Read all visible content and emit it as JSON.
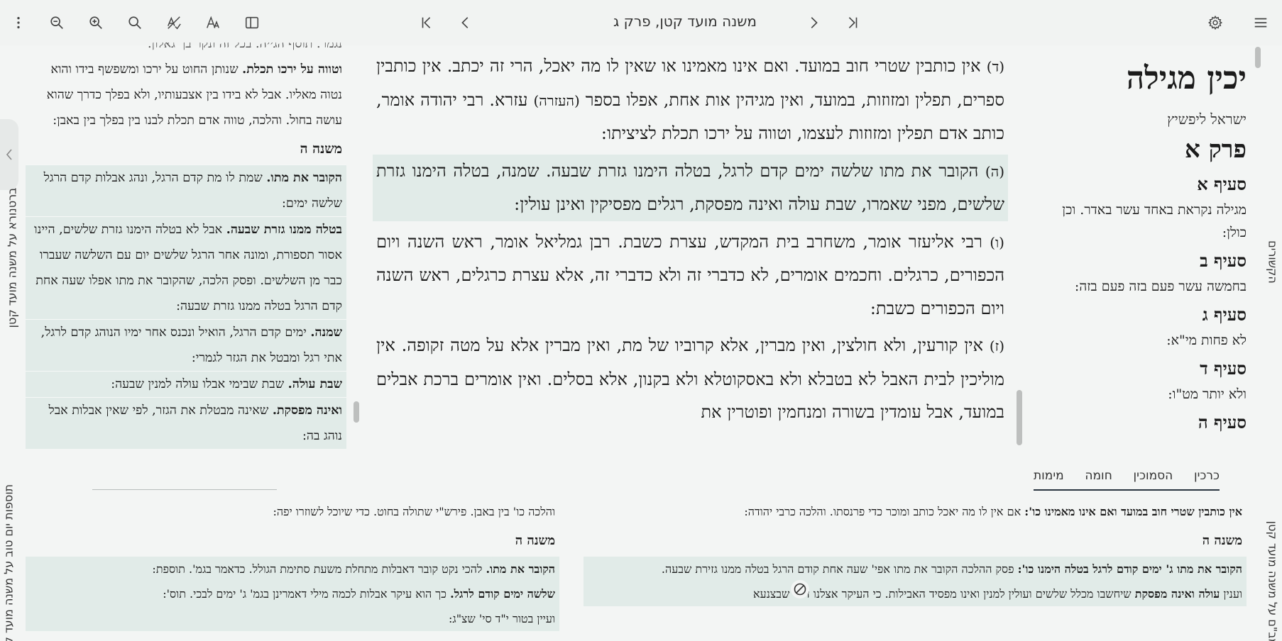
{
  "toolbar": {
    "title": "משנה מועד קטן, פרק ג",
    "icons": [
      "more-vertical-icon",
      "zoom-out-icon",
      "zoom-in-icon",
      "search-icon",
      "spellcheck-off-icon",
      "font-icon",
      "split-view-icon",
      "first-page-icon",
      "prev-page-icon",
      "next-page-icon",
      "last-page-icon",
      "settings-icon",
      "menu-icon"
    ]
  },
  "main": {
    "p4": {
      "num": "(ד)",
      "text1": " אין כותבין שטרי חוב במועד. ואם אינו מאמינו או שאין לו מה יאכל, הרי זה יכתב. אין כותבין ספרים, תפלין ומזוזות, במועד, ואין מגיהין אות אחת, אפלו בספר ",
      "ezra": "(העזרה)",
      "text2": " עזרא. רבי יהודה אומר, כותב אדם תפלין ומזוזות לעצמו, וטווה על ירכו תכלת לציציתו:"
    },
    "p5": {
      "num": "(ה)",
      "text": " הקובר את מתו שלשה ימים קדם לרגל, בטלה הימנו גזרת שבעה. שמנה, בטלה הימנו גזרת שלשים, מפני שאמרו, שבת עולה ואינה מפסקת, רגלים מפסיקין ואינן עולין:"
    },
    "p6": {
      "num": "(ו)",
      "text": " רבי אליעזר אומר, משחרב בית המקדש, עצרת כשבת. רבן גמליאל אומר, ראש השנה ויום הכפורים, כרגלים. וחכמים אומרים, לא כדברי זה ולא כדברי זה, אלא עצרת כרגלים, ראש השנה ויום הכפורים כשבת:"
    },
    "p7": {
      "num": "(ז)",
      "text": " אין קורעין, ולא חולצין, ואין מברין, אלא קרוביו של מת, ואין מברין אלא על מטה זקופה. אין מוליכין לבית האבל לא בטבלא ולא באסקוטלא ולא בקנון, אלא בסלים. ואין אומרים ברכת אבלים במועד, אבל עומדין בשורה ומנחמין ופוטרין את"
    }
  },
  "right": {
    "title": "יכין מגילה",
    "author": "ישראל ליפשיץ",
    "chapter": "פרק א",
    "sections": [
      {
        "label": "סעיף א",
        "text": "מגילה נקראת באחד עשר באדר. וכן כולן:"
      },
      {
        "label": "סעיף ב",
        "text": "בחמשה עשר פעם בזה פעם בזה:"
      },
      {
        "label": "סעיף ג",
        "text": "לא פחות מי\"א:"
      },
      {
        "label": "סעיף ד",
        "text": "ולא יותר מט\"ו:"
      },
      {
        "label": "סעיף ה",
        "text": ""
      }
    ],
    "tabs": [
      "כרכין",
      "הסמוכין",
      "חומה",
      "מימות"
    ]
  },
  "left": {
    "top_partial": "נגמר. תוסף הגייה. בכל זה ונקר בך גאלון.",
    "p_tovah": {
      "bold": "וטווה על ירכו תכלת.",
      "text": " שנותן החוט על ירכו ומשפשף בידו והוא נטוה מאליו. אבל לא בידו בין אצבעותיו, ולא בפלך כדרך שהוא עושה בחול. והלכה, טווה אדם תכלת לבנו בין בפלך בין באבן:"
    },
    "header": "משנה ה",
    "p1": {
      "bold": "הקובר את מתו.",
      "text": " שמת לו מת קדם הרגל, ונהג אבלות קדם הרגל שלשה ימים:"
    },
    "p2": {
      "bold": "בטלה ממנו גזרת שבעה.",
      "text": " אבל לא בטלה הימנו גזרת שלשים, היינו אסור תספורת, ומונה אחר הרגל שלשים יום עם השלשה שעברו כבר מן השלשים. ופסק הלכה, שהקובר את מתו אפלו שעה אחת קדם הרגל בטלה ממנו גזרת שבעה:"
    },
    "p3": {
      "bold": "שמנה.",
      "text": " ימים קדם הרגל, הואיל ונכנס אחר ימיו הנוהג קדם לרגל, אתי רגל ומבטל את הגזר לגמרי:"
    },
    "p4": {
      "bold": "שבת עולה.",
      "text": " שבת שבימי אבלו עולה למנין שבעה:"
    },
    "p5": {
      "bold": "ואינה מפסקת.",
      "text": " שאינה מבטלת את הגזר, לפי שאין אבלות אבל נוהג בה:"
    },
    "vlabel": "ברטנורא על משנה מועד קטן"
  },
  "bottom_left": {
    "top": "והלכה כו' בין באבן. פירש\"י שתולה בחוט. כדי שיוכל לשוזרו יפה:",
    "header": "משנה ה",
    "p1": {
      "bold": "הקובר את מתו.",
      "text": " להכי נקט קובר דאבלות מתחלת משעת סתימת הגולל. כדאמר בגמ'. תוספת:"
    },
    "p2": {
      "bold": "שלשה ימים קודם לרגל.",
      "text": " כך הוא עיקר אבלות לכמה מילי דאמרינן בגמ' ג' ימים לבכי. תוס':"
    },
    "p3": {
      "text": "ועיין בטור י\"ד סי' שצ\"ג:"
    },
    "vlabel": "תוספות יום טוב על משנה מועד קטן"
  },
  "bottom_right": {
    "top": {
      "bold": "אין כותבין שטרי חוב במועד ואם אינו מאמינו כו':",
      "text": " אם אין לו מה יאכל כותב ומוכר כדי פרנסתו. והלכה כרבי יהודה:"
    },
    "header": "משנה ה",
    "p1": {
      "bold": "הקובר את מתו ג' ימים קודם לרגל בטלה הימנו כו':",
      "text": " פסק ההלכה הקובר את מתו אפי' שעה אחת קודם הרגל בטלה ממנו גזירת שבעה."
    },
    "p2": {
      "text": "וענין ",
      "bold": "עולה ואינה מפסקת",
      "text2": " שיחשבו מכלל שלשים ועולין למנין ואינו מפסיד האבילות. כי העיקר אצלנו דבר שבצנעא"
    },
    "vlabel_right": "רמב\"ם על משנה מועד קטן",
    "vlabel_right_top": "הקשורים"
  }
}
